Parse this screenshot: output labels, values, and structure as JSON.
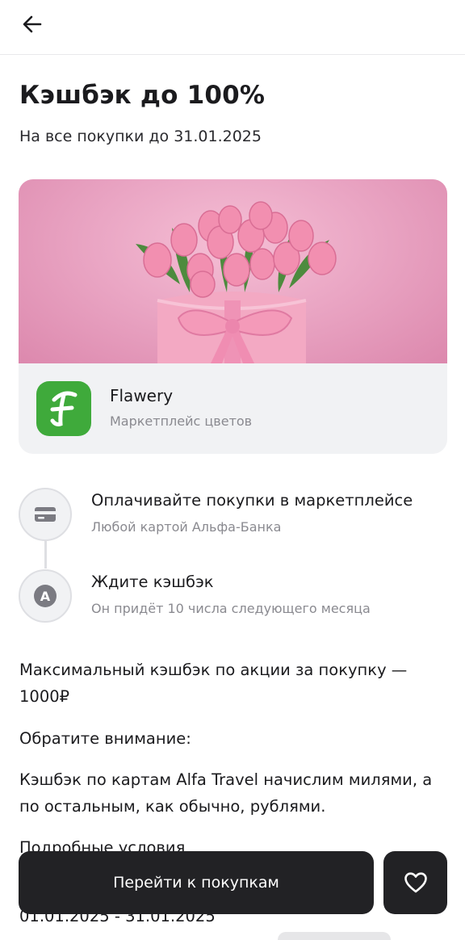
{
  "header": {
    "back_icon": "arrow-left-icon"
  },
  "promo": {
    "title": "Кэшбэк до 100%",
    "subtitle": "На все покупки до 31.01.2025"
  },
  "partner": {
    "name": "Flawery",
    "description": "Маркетплейс цветов",
    "logo_letter": "F",
    "logo_color": "#3faa3b",
    "banner_image": "pink tulips bouquet"
  },
  "steps": [
    {
      "icon": "card-icon",
      "title": "Оплачивайте покупки в маркетплейсе",
      "subtitle": "Любой картой Альфа-Банка"
    },
    {
      "icon": "alfa-logo-icon",
      "badge": "А",
      "title": "Ждите кэшбэк",
      "subtitle": "Он придёт 10 числа следующего месяца"
    }
  ],
  "details": {
    "max_cashback_line1": "Максимальный кэшбэк по акции за покупку —",
    "max_cashback_line2": "1000₽",
    "attention": "Обратите внимание:",
    "travel_note_line1": "Кэшбэк по картам Alfa Travel начислим милями, а",
    "travel_note_line2": "по остальным, как обычно, рублями.",
    "conditions_heading": "Подробные условия",
    "period": "01.01.2025 - 31.01.2025"
  },
  "actions": {
    "cta_label": "Перейти к покупкам",
    "favorite_icon": "heart-icon"
  },
  "colors": {
    "accent_dark": "#222225",
    "banner_pink": "#eaa6c4",
    "muted_text": "#8a8a90"
  }
}
